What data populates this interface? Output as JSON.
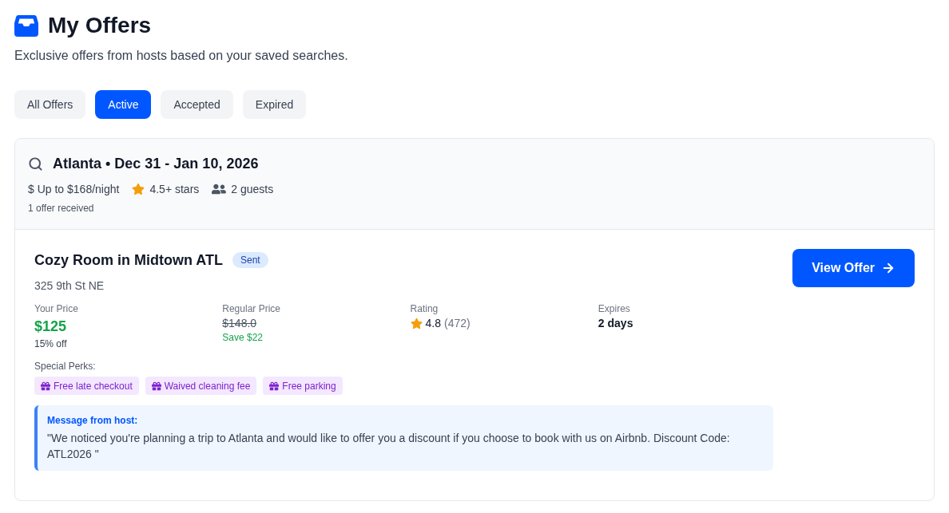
{
  "header": {
    "title": "My Offers",
    "subtitle": "Exclusive offers from hosts based on your saved searches."
  },
  "tabs": [
    {
      "label": "All Offers",
      "selected": false
    },
    {
      "label": "Active",
      "selected": true
    },
    {
      "label": "Accepted",
      "selected": false
    },
    {
      "label": "Expired",
      "selected": false
    }
  ],
  "search_groups": [
    {
      "title": "Atlanta • Dec 31 - Jan 10, 2026",
      "filters": [
        {
          "kind": "price",
          "text": "$ Up to $168/night"
        },
        {
          "kind": "rating",
          "text": "4.5+ stars"
        },
        {
          "kind": "guests",
          "text": "2 guests"
        }
      ],
      "offer_count": "1 offer received",
      "offers": [
        {
          "title": "Cozy Room in Midtown ATL",
          "status": "Sent",
          "address": "325 9th St NE",
          "stats": [
            {
              "kind": "price",
              "label": "Your Price",
              "value": "$125",
              "note": "15% off"
            },
            {
              "kind": "regular",
              "label": "Regular Price",
              "value": "$148.0",
              "note": "Save $22"
            },
            {
              "kind": "rating",
              "label": "Rating",
              "value": "4.8",
              "note": "(472)"
            },
            {
              "kind": "expires",
              "label": "Expires",
              "value": "2 days"
            }
          ],
          "perks_label": "Special Perks:",
          "perks": [
            "Free late checkout",
            "Waived cleaning fee",
            "Free parking"
          ],
          "message": {
            "label": "Message from host:",
            "text": "\"We noticed you're planning a trip to Atlanta and would like to offer you a discount if you choose to book with us on Airbnb. Discount Code: ATL2026 \""
          },
          "action": "View Offer"
        }
      ]
    }
  ]
}
